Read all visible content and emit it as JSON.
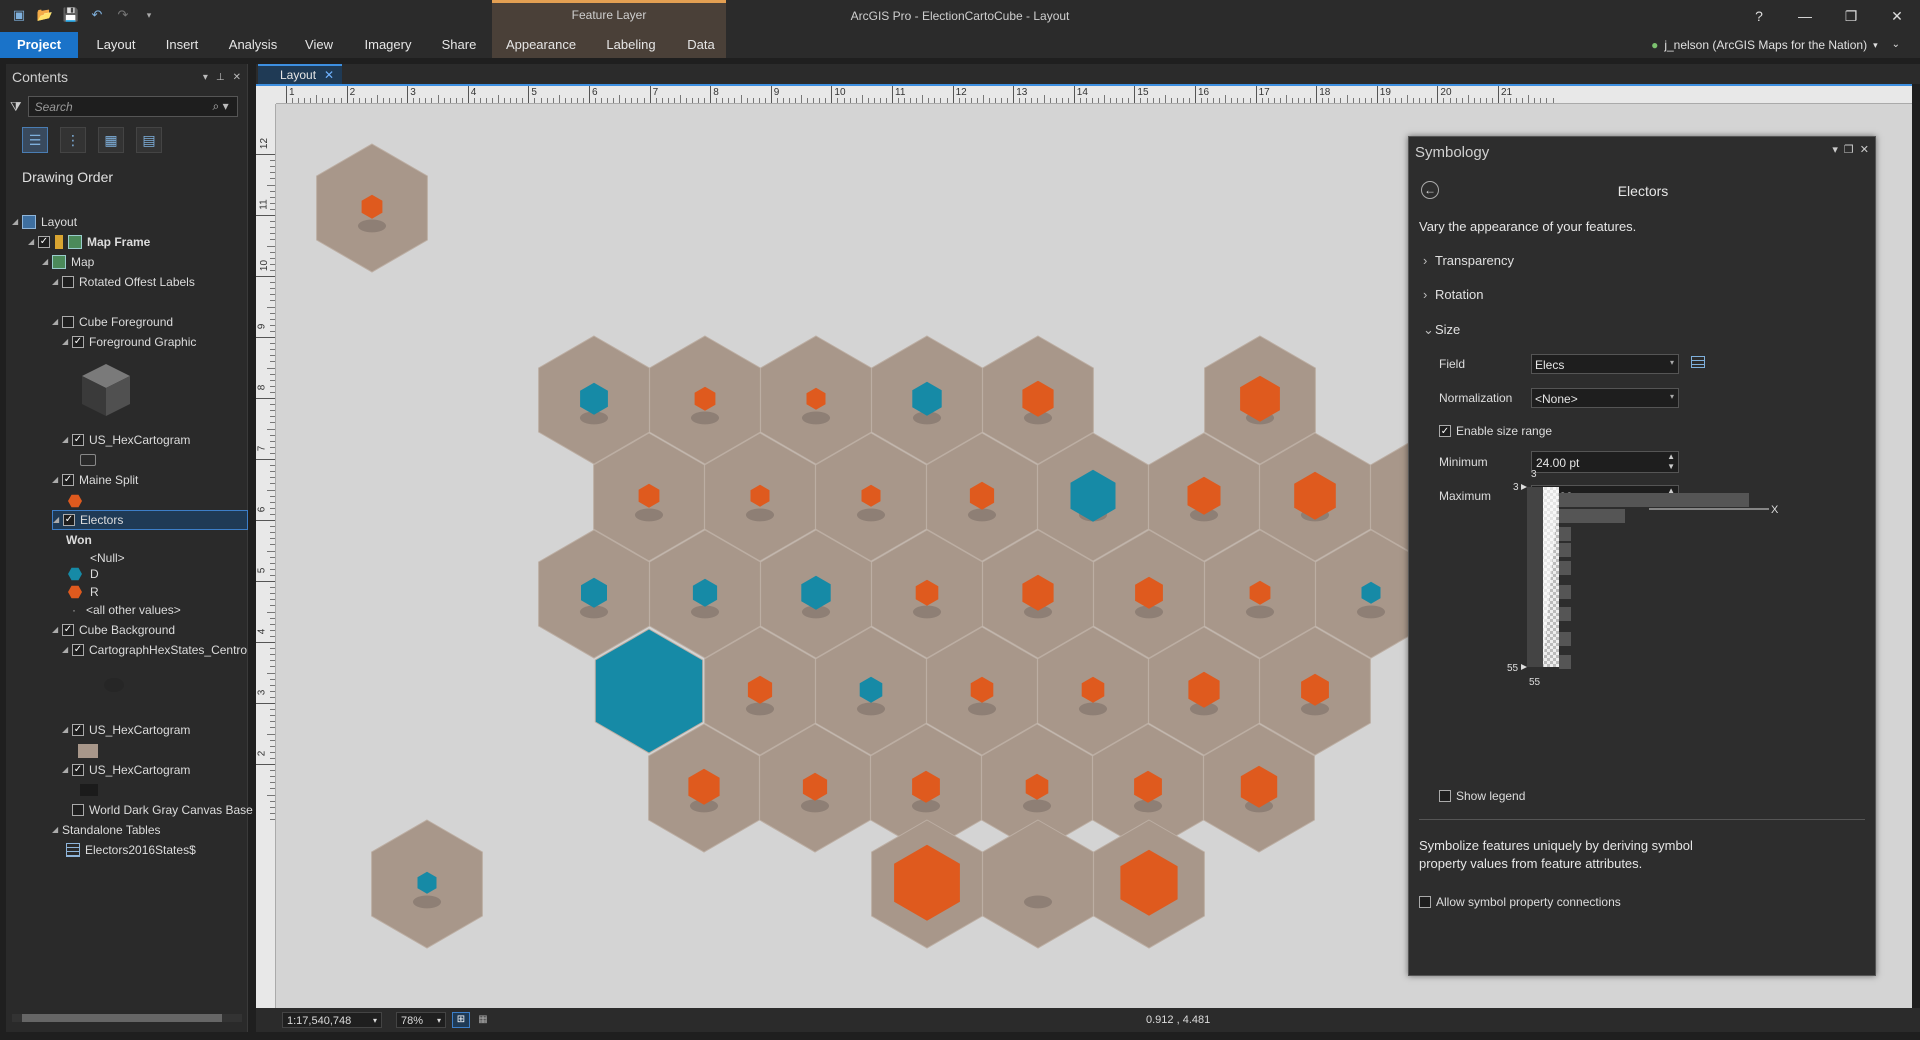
{
  "app": {
    "title": "ArcGIS Pro - ElectionCartoCube - Layout",
    "context_tab_header": "Feature Layer",
    "user": "j_nelson (ArcGIS Maps for the Nation)",
    "help": "?",
    "minimize": "—",
    "restore": "❐",
    "close": "✕"
  },
  "ribbon": {
    "tabs": [
      "Project",
      "Layout",
      "Insert",
      "Analysis",
      "View",
      "Imagery",
      "Share",
      "Appearance",
      "Labeling",
      "Data"
    ]
  },
  "contents": {
    "title": "Contents",
    "search_placeholder": "Search",
    "drawing_order": "Drawing Order",
    "items": {
      "layout": "Layout",
      "map_frame": "Map Frame",
      "map": "Map",
      "rotated_offset_labels": "Rotated Offest Labels",
      "cube_foreground": "Cube Foreground",
      "foreground_graphic": "Foreground Graphic",
      "us_hexcartogram_1": "US_HexCartogram",
      "maine_split": "Maine Split",
      "electors": "Electors",
      "won": "Won",
      "null": "<Null>",
      "d": "D",
      "r": "R",
      "all_other": "<all other values>",
      "cube_background": "Cube Background",
      "cartograph_centro": "CartographHexStates_Centro",
      "us_hexcartogram_2": "US_HexCartogram",
      "us_hexcartogram_3": "US_HexCartogram",
      "world_dark_gray": "World Dark Gray Canvas Base",
      "standalone_tables": "Standalone Tables",
      "electors_table": "Electors2016States$"
    }
  },
  "layout_view": {
    "tab_label": "Layout",
    "ruler_top": [
      "1",
      "2",
      "3",
      "4",
      "5",
      "6",
      "7",
      "8",
      "9",
      "10",
      "11",
      "12",
      "13",
      "14",
      "15",
      "16",
      "17",
      "18",
      "19",
      "20",
      "21"
    ],
    "ruler_left": [
      "12",
      "11",
      "10",
      "9",
      "8",
      "7",
      "6",
      "5",
      "4",
      "3",
      "2"
    ]
  },
  "status": {
    "scale": "1:17,540,748",
    "zoom": "78%",
    "coords": "0.912 , 4.481"
  },
  "symbology": {
    "pane_title": "Symbology",
    "layer_title": "Electors",
    "description": "Vary the appearance of your features.",
    "sections": {
      "transparency": "Transparency",
      "rotation": "Rotation",
      "size": "Size"
    },
    "field_label": "Field",
    "field_value": "Elecs",
    "normalization_label": "Normalization",
    "normalization_value": "<None>",
    "enable_size_range": "Enable size range",
    "minimum_label": "Minimum",
    "minimum_value": "24.00 pt",
    "maximum_label": "Maximum",
    "maximum_value": "120.00 pt",
    "histogram": {
      "top_label": "3",
      "bottom_label": "55",
      "min_marker": "3",
      "max_marker": "55",
      "outlier": "X"
    },
    "show_legend": "Show legend",
    "derive_text": "Symbolize features uniquely by deriving symbol property values from feature attributes.",
    "allow_connections": "Allow symbol property connections"
  },
  "colors": {
    "dem": "#168aa6",
    "rep": "#df5a1e",
    "hex_tile": "#a8978a",
    "accent": "#3d8fe0"
  }
}
